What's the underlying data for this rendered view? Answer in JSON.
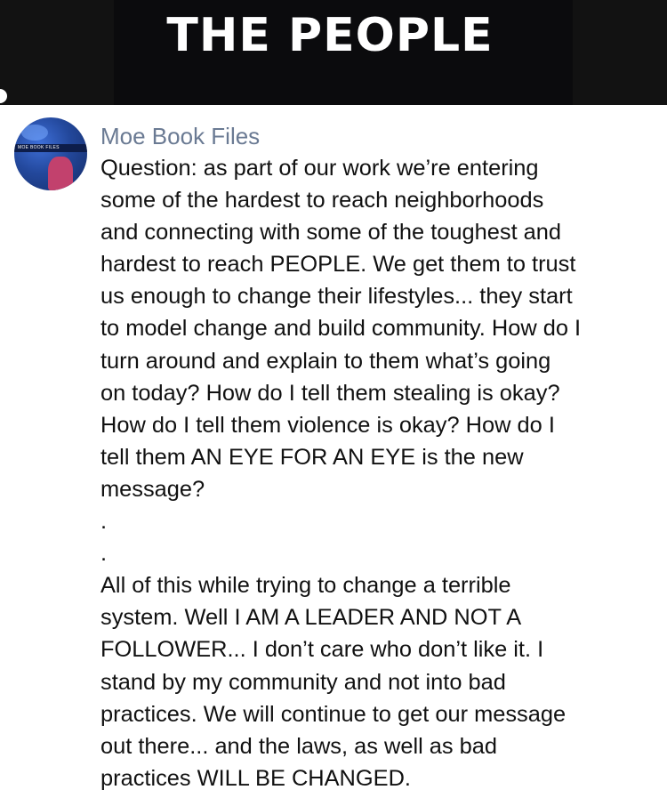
{
  "banner": {
    "title": "THE PEOPLE"
  },
  "post": {
    "author": "Moe Book Files",
    "avatar_caption": "MOE BOOK FILES",
    "lines": [
      "Question: as part of our work we’re entering",
      "some of the hardest to reach neighborhoods",
      "and connecting with some of the toughest and",
      "hardest to reach PEOPLE. We get them to trust",
      "us enough to change their lifestyles... they start",
      "to model change and build community. How do I",
      "turn around and explain to them what’s going",
      "on today? How do I tell them stealing is okay?",
      "How do I tell them violence is okay? How do I",
      "tell them AN EYE FOR AN EYE is the new",
      "message?",
      ".",
      ".",
      "All of this while trying to change a terrible",
      "system. Well I AM A LEADER AND NOT A",
      "FOLLOWER... I don’t care who don’t like it. I",
      "stand by my community and not into bad",
      "practices. We will continue to get our message",
      "out there... and the laws, as well as bad",
      "practices WILL BE CHANGED."
    ]
  },
  "colors": {
    "banner_bg": "#121212",
    "author": "#6a7a93",
    "text": "#111111"
  }
}
